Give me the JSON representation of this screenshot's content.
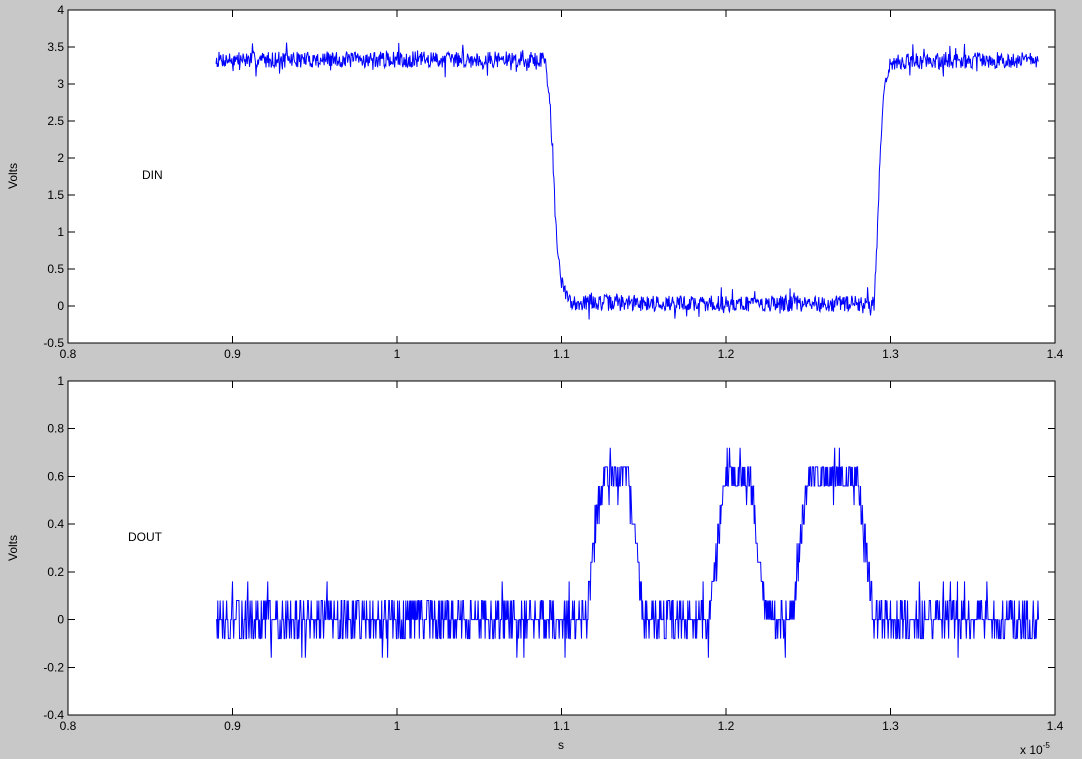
{
  "chart_data": [
    {
      "type": "line",
      "id": "din",
      "ylabel": "Volts",
      "xlabel": "",
      "xlim": [
        0.8,
        1.4
      ],
      "ylim": [
        -0.5,
        4
      ],
      "xticks": [
        "0.8",
        "0.9",
        "1",
        "1.1",
        "1.2",
        "1.3",
        "1.4"
      ],
      "yticks": [
        "-0.5",
        "0",
        "0.5",
        "1",
        "1.5",
        "2",
        "2.5",
        "3",
        "3.5",
        "4"
      ],
      "annotation": "DIN",
      "grid": false,
      "color": "#0000ff",
      "x_multiplier": "x 10^-5",
      "series": [
        {
          "x": [
            0.89,
            1.0,
            1.09,
            1.093,
            1.095,
            1.097,
            1.1,
            1.105,
            1.2,
            1.29,
            1.292,
            1.294,
            1.296,
            1.3,
            1.39
          ],
          "y": [
            3.33,
            3.33,
            3.33,
            2.8,
            1.8,
            0.9,
            0.3,
            0.05,
            0.03,
            0.03,
            1.0,
            2.2,
            2.9,
            3.3,
            3.33
          ]
        }
      ]
    },
    {
      "type": "line",
      "id": "dout",
      "ylabel": "Volts",
      "xlabel": "s",
      "xlim": [
        0.8,
        1.4
      ],
      "ylim": [
        -0.4,
        1
      ],
      "xticks": [
        "0.8",
        "0.9",
        "1",
        "1.1",
        "1.2",
        "1.3",
        "1.4"
      ],
      "yticks": [
        "-0.4",
        "-0.2",
        "0",
        "0.2",
        "0.4",
        "0.6",
        "0.8",
        "1"
      ],
      "annotation": "DOUT",
      "grid": false,
      "color": "#0000ff",
      "x_multiplier": "x 10^-5",
      "series": [
        {
          "x": [
            0.89,
            1.0,
            1.115,
            1.12,
            1.125,
            1.14,
            1.145,
            1.15,
            1.19,
            1.195,
            1.2,
            1.215,
            1.22,
            1.225,
            1.24,
            1.245,
            1.25,
            1.28,
            1.285,
            1.29,
            1.39
          ],
          "y": [
            0.0,
            0.0,
            0.0,
            0.35,
            0.6,
            0.6,
            0.3,
            0.0,
            0.0,
            0.35,
            0.58,
            0.58,
            0.25,
            0.0,
            0.0,
            0.35,
            0.6,
            0.6,
            0.3,
            0.0,
            0.0
          ]
        }
      ]
    }
  ],
  "exponent_label": {
    "prefix": "x 10",
    "exponent": "-5"
  }
}
